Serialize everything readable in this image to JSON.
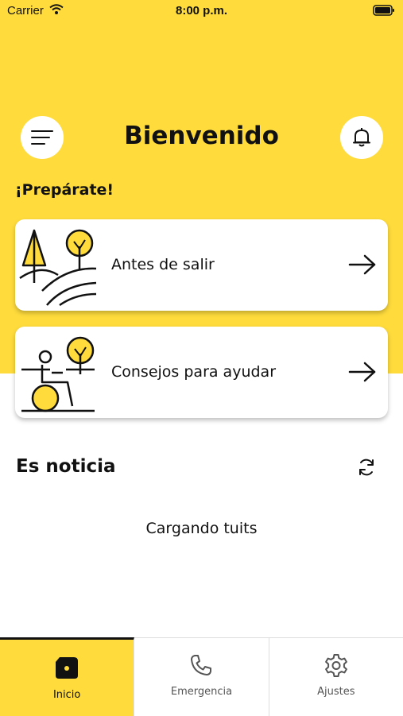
{
  "status_bar": {
    "carrier": "Carrier",
    "time": "8:00 p.m."
  },
  "header": {
    "title": "Bienvenido",
    "menu_icon": "hamburger-menu-icon",
    "bell_icon": "bell-icon"
  },
  "prepare_label": "¡Prepárate!",
  "cards": [
    {
      "label": "Antes de salir",
      "icon": "landscape-trees-illustration"
    },
    {
      "label": "Consejos para ayudar",
      "icon": "wheelchair-person-illustration"
    }
  ],
  "news": {
    "title": "Es noticia",
    "loading": "Cargando tuits"
  },
  "tabs": [
    {
      "label": "Inicio",
      "icon": "home-icon",
      "active": true
    },
    {
      "label": "Emergencia",
      "icon": "phone-icon",
      "active": false
    },
    {
      "label": "Ajustes",
      "icon": "gear-icon",
      "active": false
    }
  ],
  "colors": {
    "accent": "#FFDC3C",
    "text": "#111111"
  }
}
